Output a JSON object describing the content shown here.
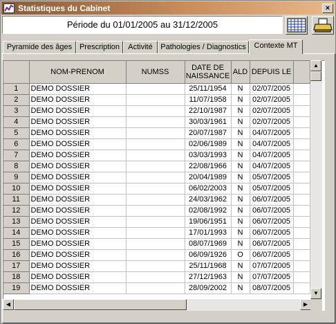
{
  "window": {
    "title": "Statistiques du Cabinet",
    "close_label": "×"
  },
  "period": "Période du 01/01/2005 au 31/12/2005",
  "tabs": [
    {
      "label": "Pyramide des âges"
    },
    {
      "label": "Prescription"
    },
    {
      "label": "Activité"
    },
    {
      "label": "Pathologies / Diagnostics"
    },
    {
      "label": "Contexte MT"
    }
  ],
  "table": {
    "headers": [
      "NOM-PRENOM",
      "NUMSS",
      "DATE DE NAISSANCE",
      "ALD",
      "DEPUIS LE"
    ],
    "rows": [
      {
        "n": "1",
        "name": "DEMO DOSSIER",
        "numss": "",
        "dob": "25/11/1954",
        "ald": "N",
        "since": "02/07/2005"
      },
      {
        "n": "2",
        "name": "DEMO DOSSIER",
        "numss": "",
        "dob": "11/07/1958",
        "ald": "N",
        "since": "02/07/2005"
      },
      {
        "n": "3",
        "name": "DEMO DOSSIER",
        "numss": "",
        "dob": "22/10/1987",
        "ald": "N",
        "since": "02/07/2005"
      },
      {
        "n": "4",
        "name": "DEMO DOSSIER",
        "numss": "",
        "dob": "30/03/1961",
        "ald": "N",
        "since": "02/07/2005"
      },
      {
        "n": "5",
        "name": "DEMO DOSSIER",
        "numss": "",
        "dob": "20/07/1987",
        "ald": "N",
        "since": "04/07/2005"
      },
      {
        "n": "6",
        "name": "DEMO DOSSIER",
        "numss": "",
        "dob": "02/06/1989",
        "ald": "N",
        "since": "04/07/2005"
      },
      {
        "n": "7",
        "name": "DEMO DOSSIER",
        "numss": "",
        "dob": "03/03/1993",
        "ald": "N",
        "since": "04/07/2005"
      },
      {
        "n": "8",
        "name": "DEMO DOSSIER",
        "numss": "",
        "dob": "22/08/1966",
        "ald": "N",
        "since": "04/07/2005"
      },
      {
        "n": "9",
        "name": "DEMO DOSSIER",
        "numss": "",
        "dob": "20/04/1989",
        "ald": "N",
        "since": "05/07/2005"
      },
      {
        "n": "10",
        "name": "DEMO DOSSIER",
        "numss": "",
        "dob": "06/02/2003",
        "ald": "N",
        "since": "05/07/2005"
      },
      {
        "n": "11",
        "name": "DEMO DOSSIER",
        "numss": "",
        "dob": "24/03/1962",
        "ald": "N",
        "since": "06/07/2005"
      },
      {
        "n": "12",
        "name": "DEMO DOSSIER",
        "numss": "",
        "dob": "02/08/1992",
        "ald": "N",
        "since": "06/07/2005"
      },
      {
        "n": "13",
        "name": "DEMO DOSSIER",
        "numss": "",
        "dob": "19/06/1951",
        "ald": "N",
        "since": "06/07/2005"
      },
      {
        "n": "14",
        "name": "DEMO DOSSIER",
        "numss": "",
        "dob": "17/01/1993",
        "ald": "N",
        "since": "06/07/2005"
      },
      {
        "n": "15",
        "name": "DEMO DOSSIER",
        "numss": "",
        "dob": "08/07/1969",
        "ald": "N",
        "since": "06/07/2005"
      },
      {
        "n": "16",
        "name": "DEMO DOSSIER",
        "numss": "",
        "dob": "06/09/1926",
        "ald": "O",
        "since": "06/07/2005"
      },
      {
        "n": "17",
        "name": "DEMO DOSSIER",
        "numss": "",
        "dob": "25/11/1968",
        "ald": "N",
        "since": "07/07/2005"
      },
      {
        "n": "18",
        "name": "DEMO DOSSIER",
        "numss": "",
        "dob": "27/12/1963",
        "ald": "N",
        "since": "07/07/2005"
      },
      {
        "n": "19",
        "name": "DEMO DOSSIER",
        "numss": "",
        "dob": "28/09/2002",
        "ald": "N",
        "since": "08/07/2005"
      }
    ]
  },
  "icons": {
    "window": "chart-icon",
    "grid": "grid-table-icon",
    "print": "printer-icon"
  },
  "colors": {
    "titlebar_start": "#8a5a38",
    "titlebar_end": "#e9b889",
    "face": "#d4d0c8"
  }
}
